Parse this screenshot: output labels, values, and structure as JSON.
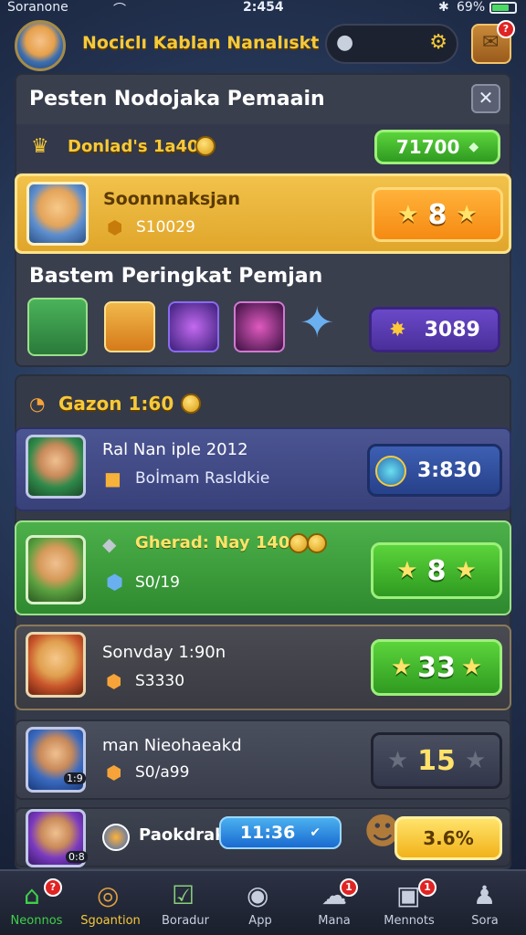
{
  "status": {
    "carrier": "Soranone",
    "time": "2:454",
    "battery": "69%"
  },
  "header": {
    "title": "Nociclı Kablan Nanalıskt",
    "search_placeholder": "",
    "notif_count": "?"
  },
  "panel1": {
    "title": "Pesten Nodojaka Pemaain",
    "subheading": "Donlad's 1a40",
    "subheading_value": "71700",
    "featured": {
      "name": "Soonnnaksjan",
      "score": "S10029",
      "stars": "8"
    },
    "section2_title": "Bastem Peringkat Pemjan",
    "section2_value": "3089"
  },
  "panel2": {
    "title": "Gazon 1:60",
    "rows": [
      {
        "name": "Ral Nan iple 2012",
        "sub": "Boİmam Rasldkie",
        "value": "3:830"
      },
      {
        "name": "Gherad: Nay 140",
        "sub": "S0/19",
        "value": "8"
      },
      {
        "name": "Sonvday 1:90n",
        "sub": "S3330",
        "value": "33"
      },
      {
        "name": "man Nieohaeakd",
        "sub": "S0/a99",
        "value": "15",
        "badge": "1:9"
      },
      {
        "name": "Paokdrak",
        "sub": "",
        "timer": "11:36",
        "value": "3.6%",
        "badge": "0:8"
      }
    ]
  },
  "nav": [
    {
      "label": "Neonnos",
      "badge": "?"
    },
    {
      "label": "Sgoantion",
      "badge": ""
    },
    {
      "label": "Boradur",
      "badge": ""
    },
    {
      "label": "App",
      "badge": ""
    },
    {
      "label": "Mana",
      "badge": "1"
    },
    {
      "label": "Mennots",
      "badge": "1"
    },
    {
      "label": "Sora",
      "badge": ""
    }
  ],
  "colors": {
    "accent": "#f6c93a",
    "green": "#3fb02b",
    "orange": "#f7a51d",
    "panel": "#3a3f4e"
  }
}
